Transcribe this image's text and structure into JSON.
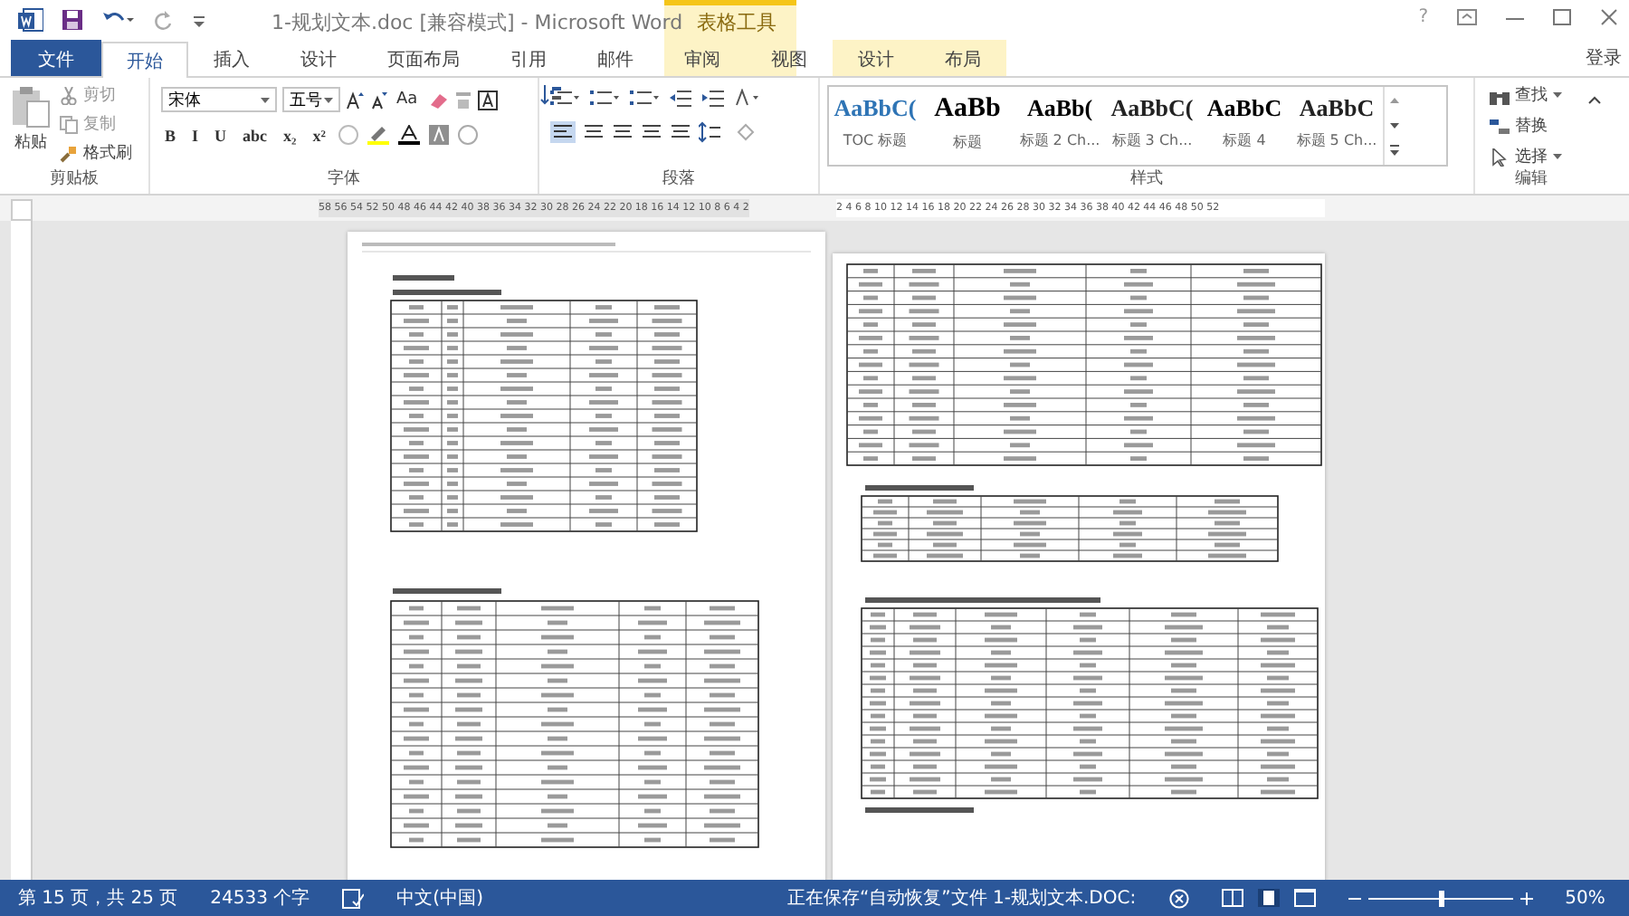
{
  "window": {
    "title": "1-规划文本.doc [兼容模式] - Microsoft Word",
    "context_group": "表格工具",
    "help": "?"
  },
  "tabs": [
    {
      "label": "文件",
      "kind": "file",
      "selected": false
    },
    {
      "label": "开始",
      "kind": "normal",
      "selected": true
    },
    {
      "label": "插入",
      "kind": "normal",
      "selected": false
    },
    {
      "label": "设计",
      "kind": "normal",
      "selected": false
    },
    {
      "label": "页面布局",
      "kind": "normal",
      "selected": false
    },
    {
      "label": "引用",
      "kind": "normal",
      "selected": false
    },
    {
      "label": "邮件",
      "kind": "normal",
      "selected": false
    },
    {
      "label": "审阅",
      "kind": "normal",
      "selected": false
    },
    {
      "label": "视图",
      "kind": "normal",
      "selected": false
    },
    {
      "label": "设计",
      "kind": "context",
      "selected": false
    },
    {
      "label": "布局",
      "kind": "context",
      "selected": false
    }
  ],
  "account": "登录",
  "clipboard": {
    "paste": "粘贴",
    "cut": "剪切",
    "copy": "复制",
    "format_painter": "格式刷",
    "label": "剪贴板"
  },
  "font": {
    "name": "宋体",
    "size": "五号",
    "case_button": "Aa",
    "format_buttons": [
      "B",
      "I",
      "U",
      "abc",
      "x₂",
      "x²"
    ],
    "label": "字体"
  },
  "paragraph": {
    "label": "段落"
  },
  "styles": {
    "items": [
      {
        "preview": "AaBbC(",
        "name": "TOC 标题"
      },
      {
        "preview": "AaBb",
        "name": "标题"
      },
      {
        "preview": "AaBb(",
        "name": "标题 2 Ch..."
      },
      {
        "preview": "AaBbC(",
        "name": "标题 3 Ch..."
      },
      {
        "preview": "AaBbC",
        "name": "标题 4"
      },
      {
        "preview": "AaBbC",
        "name": "标题 5 Ch..."
      }
    ],
    "label": "样式"
  },
  "editing": {
    "find": "查找",
    "replace": "替换",
    "select": "选择",
    "label": "编辑"
  },
  "ruler": {
    "left": "58 56 54 52 50 48 46 44 42 40 38 36 34 32 30 28 26 24 22 20 18 16 14 12 10 8 6 4 2",
    "right": "2 4 6 8 10 12 14 16 18 20 22 24 26 28 30 32 34 36 38 40 42 44 46 48 50 52"
  },
  "status_bar": {
    "page": "第 15 页，共 25 页",
    "words": "24533 个字",
    "language": "中文(中国)",
    "message": "正在保存“自动恢复”文件 1-规划文本.DOC:",
    "zoom": "50%",
    "zoom_slider": {
      "level": 0.5
    }
  }
}
